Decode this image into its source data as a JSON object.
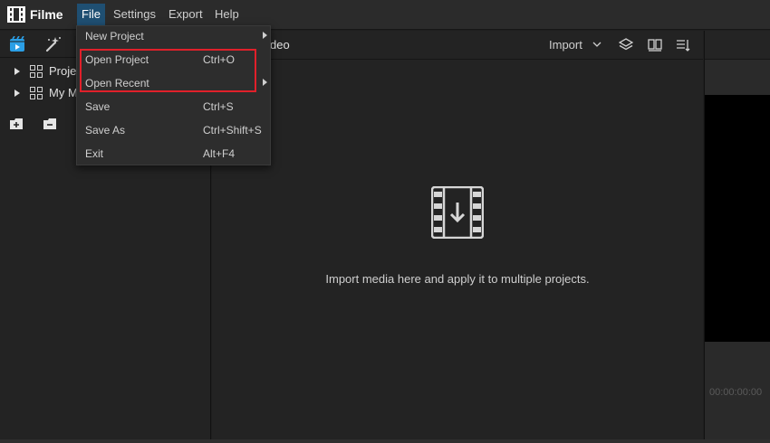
{
  "app": {
    "name": "Filme"
  },
  "menubar": {
    "items": [
      {
        "label": "File"
      },
      {
        "label": "Settings"
      },
      {
        "label": "Export"
      },
      {
        "label": "Help"
      }
    ]
  },
  "file_menu": {
    "items": [
      {
        "label": "New Project",
        "shortcut": "",
        "submenu": true
      },
      {
        "label": "Open Project",
        "shortcut": "Ctrl+O",
        "submenu": false
      },
      {
        "label": "Open Recent",
        "shortcut": "",
        "submenu": true
      },
      {
        "label": "Save",
        "shortcut": "Ctrl+S",
        "submenu": false
      },
      {
        "label": "Save As",
        "shortcut": "Ctrl+Shift+S",
        "submenu": false
      },
      {
        "label": "Exit",
        "shortcut": "Alt+F4",
        "submenu": false
      }
    ],
    "highlight_color": "#e0202a"
  },
  "left_panel": {
    "tree": [
      {
        "label": "Projec"
      },
      {
        "label": "My M"
      }
    ],
    "tab_icons": [
      "media-icon",
      "effects-icon"
    ],
    "footer_icons": [
      "add-folder-icon",
      "remove-folder-icon"
    ]
  },
  "center_panel": {
    "tab_label": "deo",
    "import_label": "Import",
    "empty_message": "Import media here and apply it to multiple projects.",
    "header_icons": [
      "layers-icon",
      "grid-view-icon",
      "sort-icon"
    ]
  },
  "right_panel": {
    "timecode": "00:00:00:00"
  },
  "colors": {
    "accent": "#1f4f72",
    "app_icon": "#2b9fe6",
    "background": "#232323"
  }
}
